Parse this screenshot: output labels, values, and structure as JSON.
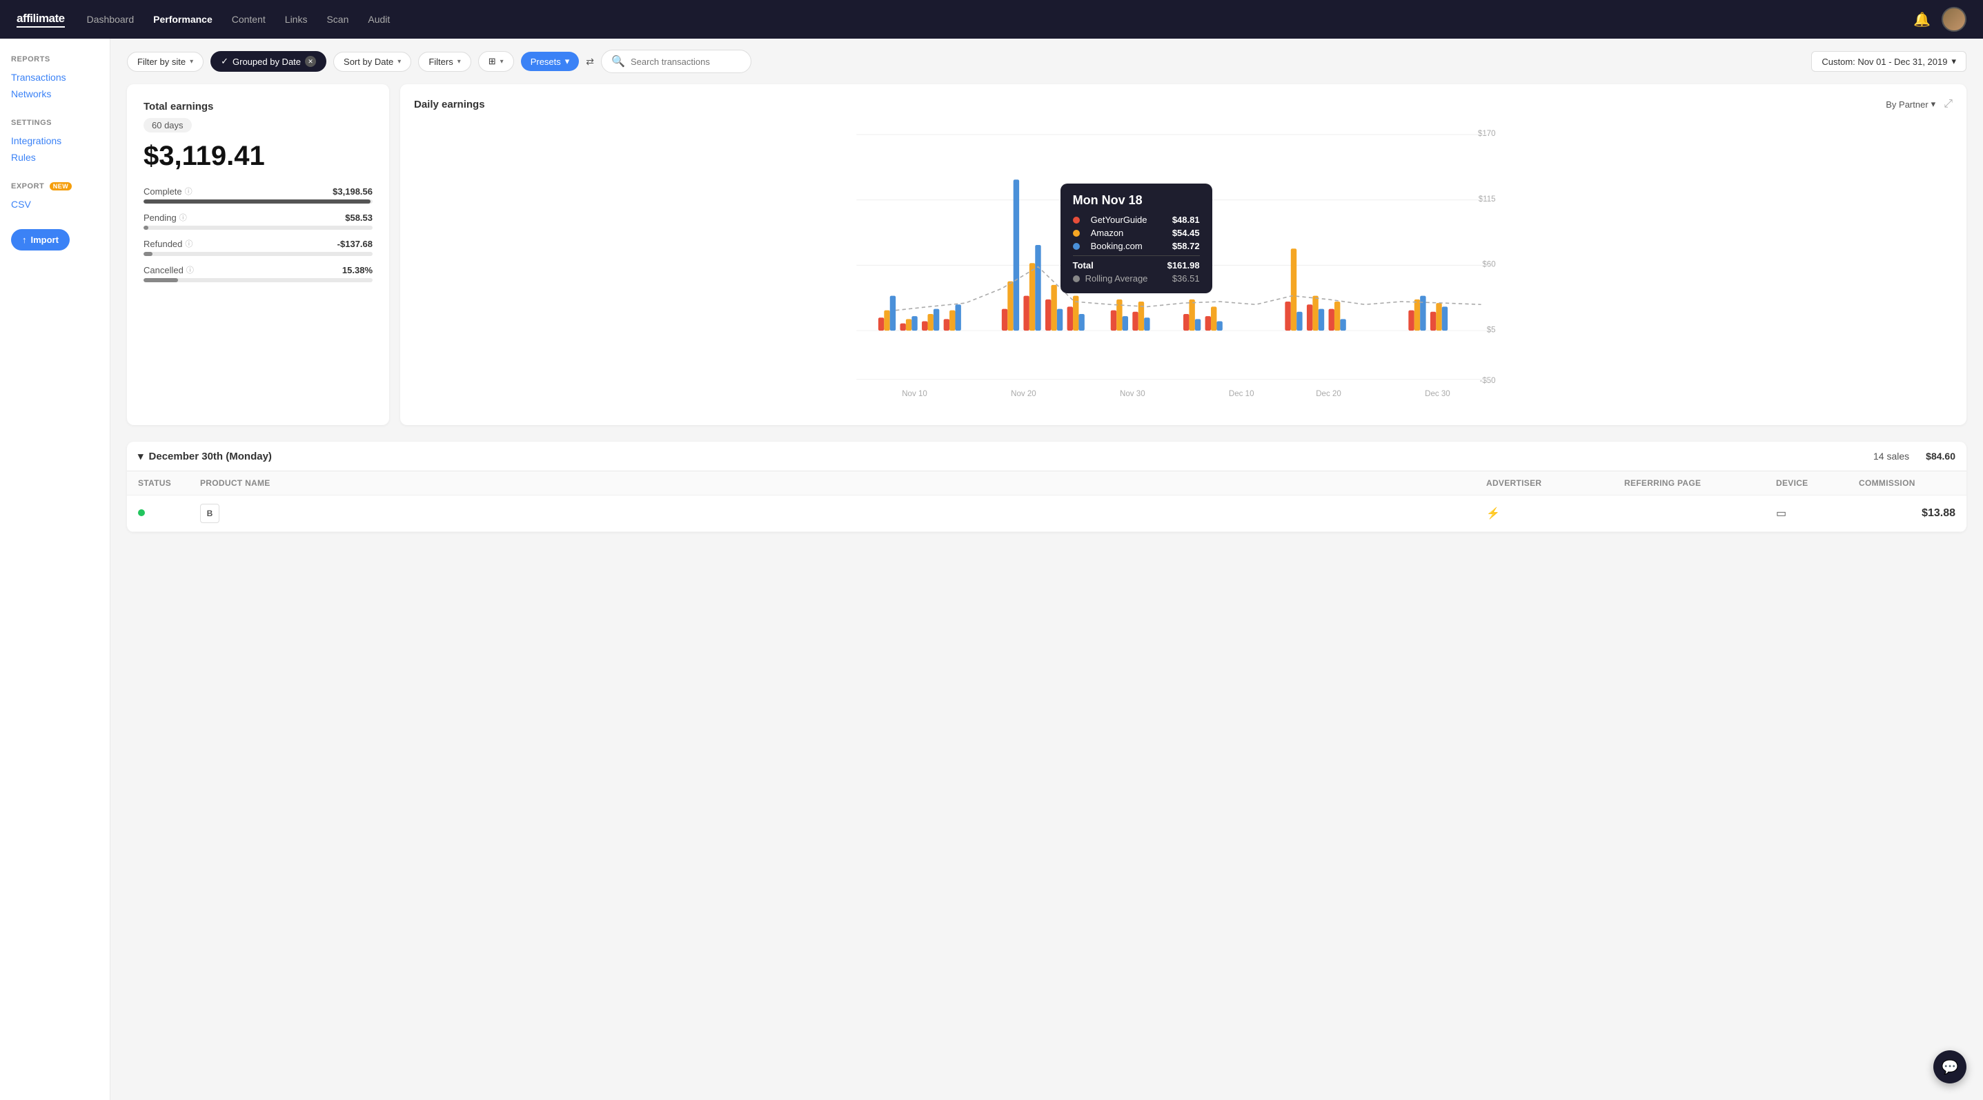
{
  "app": {
    "logo": "affilimate",
    "nav": [
      {
        "label": "Dashboard",
        "active": false
      },
      {
        "label": "Performance",
        "active": true
      },
      {
        "label": "Content",
        "active": false
      },
      {
        "label": "Links",
        "active": false
      },
      {
        "label": "Scan",
        "active": false
      },
      {
        "label": "Audit",
        "active": false
      }
    ]
  },
  "sidebar": {
    "reports_heading": "REPORTS",
    "reports_links": [
      "Transactions",
      "Networks"
    ],
    "settings_heading": "SETTINGS",
    "settings_links": [
      "Integrations",
      "Rules"
    ],
    "export_heading": "EXPORT",
    "export_badge": "NEW",
    "export_links": [
      "CSV"
    ],
    "import_label": "Import"
  },
  "toolbar": {
    "filter_by_site": "Filter by site",
    "grouped_by_date": "Grouped by Date",
    "sort_by_date": "Sort by Date",
    "filters": "Filters",
    "columns": "",
    "presets": "Presets",
    "search_placeholder": "Search transactions",
    "date_range": "Custom: Nov 01 - Dec 31, 2019"
  },
  "totals_card": {
    "title": "Total earnings",
    "days": "60 days",
    "amount": "$3,119.41",
    "complete_label": "Complete",
    "complete_value": "$3,198.56",
    "complete_pct": 99,
    "pending_label": "Pending",
    "pending_value": "$58.53",
    "pending_pct": 2,
    "refunded_label": "Refunded",
    "refunded_value": "-$137.68",
    "refunded_pct": 4,
    "cancelled_label": "Cancelled",
    "cancelled_value": "15.38%",
    "cancelled_pct": 15
  },
  "chart": {
    "title": "Daily earnings",
    "by_partner": "By Partner",
    "tooltip": {
      "date": "Mon Nov 18",
      "rows": [
        {
          "label": "GetYourGuide",
          "value": "$48.81",
          "color": "#e84e3a"
        },
        {
          "label": "Amazon",
          "value": "$54.45",
          "color": "#f5a623"
        },
        {
          "label": "Booking.com",
          "value": "$58.72",
          "color": "#4a90d9"
        }
      ],
      "total_label": "Total",
      "total_value": "$161.98",
      "rolling_label": "Rolling Average",
      "rolling_value": "$36.51"
    },
    "x_labels": [
      "Nov 10",
      "Nov 20",
      "Nov 30",
      "Dec 10",
      "Dec 20",
      "Dec 30"
    ],
    "y_labels": [
      "$170",
      "$115",
      "$60",
      "$5",
      "-$50"
    ]
  },
  "transactions": {
    "section_title": "December 30th (Monday)",
    "sales_count": "14 sales",
    "total_amount": "$84.60",
    "columns": [
      "Status",
      "Product name",
      "Advertiser",
      "Referring Page",
      "Device",
      "Commission"
    ],
    "rows": [
      {
        "status_color": "#22c55e",
        "product_icon": "B",
        "product_name": "",
        "advertiser_icon": "⚡",
        "advertiser_name": "",
        "referring_page": "",
        "device_icon": "▭",
        "commission": "$13.88"
      }
    ]
  }
}
